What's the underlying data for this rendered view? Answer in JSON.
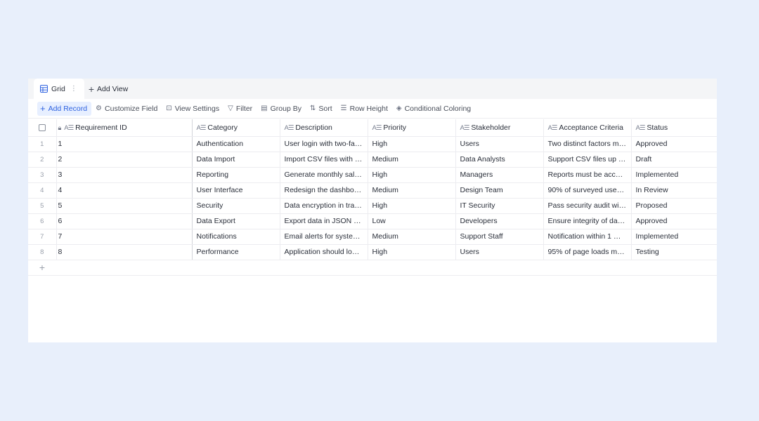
{
  "tabs": {
    "grid_label": "Grid",
    "grid_icon": "grid-table-icon",
    "more_icon": "more-vertical-icon",
    "add_view_label": "Add View"
  },
  "toolbar": {
    "add_record": "Add Record",
    "customize_field": "Customize Field",
    "view_settings": "View Settings",
    "filter": "Filter",
    "group_by": "Group By",
    "sort": "Sort",
    "row_height": "Row Height",
    "conditional_coloring": "Conditional Coloring",
    "accent_color": "#2f63e0"
  },
  "columns": {
    "id": "Requirement ID",
    "category": "Category",
    "description": "Description",
    "priority": "Priority",
    "stakeholder": "Stakeholder",
    "acceptance": "Acceptance Criteria",
    "status": "Status"
  },
  "rows": [
    {
      "num": "1",
      "id": "1",
      "category": "Authentication",
      "description": "User login with two-fact...",
      "priority": "High",
      "stakeholder": "Users",
      "acceptance": "Two distinct factors mus...",
      "status": "Approved"
    },
    {
      "num": "2",
      "id": "2",
      "category": "Data Import",
      "description": "Import CSV files with cu...",
      "priority": "Medium",
      "stakeholder": "Data Analysts",
      "acceptance": "Support CSV files up to ...",
      "status": "Draft"
    },
    {
      "num": "3",
      "id": "3",
      "category": "Reporting",
      "description": "Generate monthly sales ...",
      "priority": "High",
      "stakeholder": "Managers",
      "acceptance": "Reports must be accurat...",
      "status": "Implemented"
    },
    {
      "num": "4",
      "id": "4",
      "category": "User Interface",
      "description": "Redesign the dashboard...",
      "priority": "Medium",
      "stakeholder": "Design Team",
      "acceptance": "90% of surveyed users f...",
      "status": "In Review"
    },
    {
      "num": "5",
      "id": "5",
      "category": "Security",
      "description": "Data encryption in trans...",
      "priority": "High",
      "stakeholder": "IT Security",
      "acceptance": "Pass security audit with ...",
      "status": "Proposed"
    },
    {
      "num": "6",
      "id": "6",
      "category": "Data Export",
      "description": "Export data in JSON for...",
      "priority": "Low",
      "stakeholder": "Developers",
      "acceptance": "Ensure integrity of data ...",
      "status": "Approved"
    },
    {
      "num": "7",
      "id": "7",
      "category": "Notifications",
      "description": "Email alerts for system ...",
      "priority": "Medium",
      "stakeholder": "Support Staff",
      "acceptance": "Notification within 1 min...",
      "status": "Implemented"
    },
    {
      "num": "8",
      "id": "8",
      "category": "Performance",
      "description": "Application should load ...",
      "priority": "High",
      "stakeholder": "Users",
      "acceptance": "95% of page loads mee...",
      "status": "Testing"
    }
  ]
}
